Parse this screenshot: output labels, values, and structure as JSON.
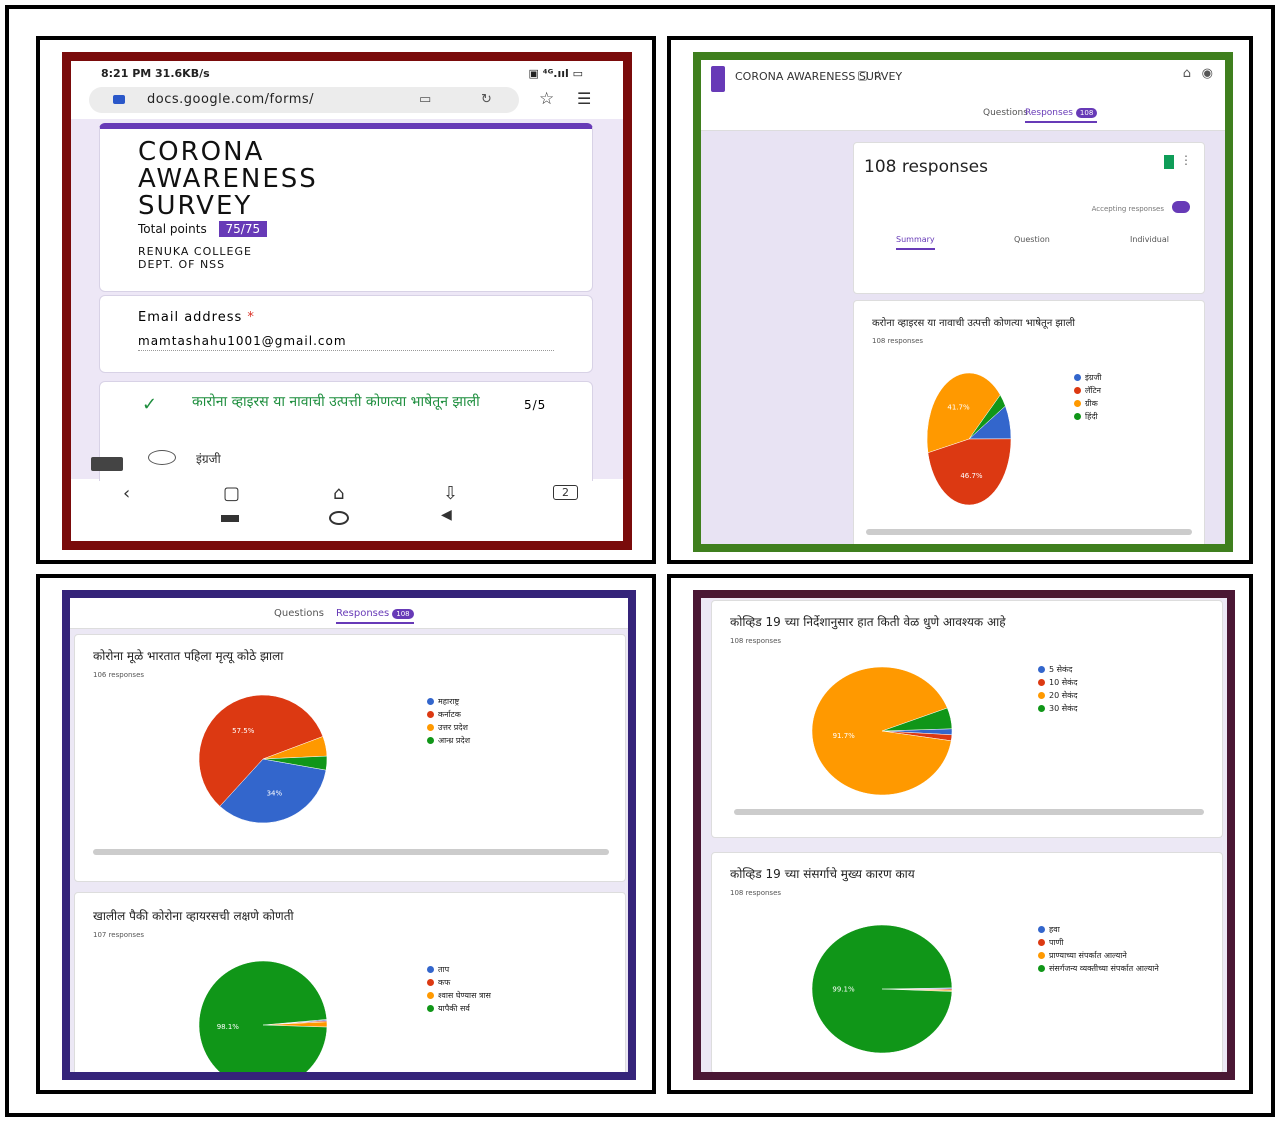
{
  "phone": {
    "status_left": "8:21 PM  31.6KB/s",
    "status_right": "▣ ⁴ᴳ.ııl ▭",
    "url": "docs.google.com/forms/",
    "form_title": "CORONA AWARENESS SURVEY",
    "total_points_label": "Total points",
    "total_points_value": "75/75",
    "college_line1": "RENUKA COLLEGE",
    "college_line2": "DEPT. OF NSS",
    "email_label": "Email address",
    "email_required": "*",
    "email_value": "mamtashahu1001@gmail.com",
    "question": "कारोना व्हाइरस या नावाची उत्पत्ती कोणत्या भाषेतून झाली",
    "question_score": "5/5",
    "option1": "इंग्रजी",
    "tabs_count": "2"
  },
  "panel_tr": {
    "form_title": "CORONA AWARENESS SURVEY",
    "tab_questions": "Questions",
    "tab_responses": "Responses",
    "responses_count": "108",
    "responses_heading": "108 responses",
    "accepting": "Accepting responses",
    "subtab_summary": "Summary",
    "subtab_question": "Question",
    "subtab_individual": "Individual",
    "q_title": "करोना व्हाइरस या नावाची उत्पत्ती कोणत्या भाषेतून झाली",
    "q_count": "108 responses",
    "legend": [
      "इंग्रजी",
      "लॅटिन",
      "ग्रीक",
      "हिंदी"
    ],
    "colors": [
      "#3366cc",
      "#dc3912",
      "#ff9900",
      "#109618"
    ],
    "chart_data": {
      "type": "pie",
      "categories": [
        "इंग्रजी",
        "लॅटिन",
        "ग्रीक",
        "हिंदी"
      ],
      "values": [
        8.3,
        46.7,
        41.7,
        3.3
      ],
      "labels": [
        "",
        "46.7%",
        "41.7%",
        ""
      ]
    }
  },
  "panel_bl": {
    "tab_questions": "Questions",
    "tab_responses": "Responses",
    "responses_count": "108",
    "q1_title": "कोरोना मूळे भारतात पहिला मृत्यू कोठे झाला",
    "q1_count": "106 responses",
    "q1_legend": [
      "महाराष्ट्र",
      "कर्नाटक",
      "उत्तर प्रदेश",
      "आन्ध्र प्रदेश"
    ],
    "q2_title": "खालील पैकी कोरोना व्हायरसची लक्षणे कोणती",
    "q2_count": "107 responses",
    "q2_legend": [
      "ताप",
      "कफ",
      "श्वास घेण्यास त्रास",
      "यापैकी सर्व"
    ],
    "colors": [
      "#3366cc",
      "#dc3912",
      "#ff9900",
      "#109618"
    ],
    "chart_data": [
      {
        "type": "pie",
        "categories": [
          "महाराष्ट्र",
          "कर्नाटक",
          "उत्तर प्रदेश",
          "आन्ध्र प्रदेश"
        ],
        "values": [
          34,
          57.5,
          5,
          3.5
        ],
        "labels": [
          "34%",
          "57.5%",
          "",
          ""
        ]
      },
      {
        "type": "pie",
        "categories": [
          "ताप",
          "कफ",
          "श्वास घेण्यास त्रास",
          "यापैकी सर्व"
        ],
        "values": [
          0.3,
          0.3,
          1.3,
          98.1
        ],
        "labels": [
          "",
          "",
          "",
          "98.1%"
        ]
      }
    ]
  },
  "panel_br": {
    "q1_title": "कोव्हिड 19 च्या निर्देशानुसार हात किती वेळ धुणे आवश्यक आहे",
    "q1_count": "108 responses",
    "q1_legend": [
      "5 सेकंद",
      "10 सेकंद",
      "20 सेकंद",
      "30 सेकंद"
    ],
    "q2_title": "कोव्हिड 19 च्या संसर्गाचे मुख्य कारण काय",
    "q2_count": "108 responses",
    "q2_legend": [
      "हवा",
      "पाणी",
      "प्राण्याच्या संपर्कात आल्याने",
      "संसर्गजन्य व्यक्तीच्या संपर्कात आल्याने"
    ],
    "colors": [
      "#3366cc",
      "#dc3912",
      "#ff9900",
      "#109618"
    ],
    "chart_data": [
      {
        "type": "pie",
        "categories": [
          "5 सेकंद",
          "10 सेकंद",
          "20 सेकंद",
          "30 सेकंद"
        ],
        "values": [
          1.5,
          1.5,
          91.7,
          5.3
        ],
        "labels": [
          "",
          "",
          "91.7%",
          ""
        ]
      },
      {
        "type": "pie",
        "categories": [
          "हवा",
          "पाणी",
          "प्राण्याच्या संपर्कात आल्याने",
          "संसर्गजन्य व्यक्तीच्या संपर्कात आल्याने"
        ],
        "values": [
          0.3,
          0.3,
          0.3,
          99.1
        ],
        "labels": [
          "",
          "",
          "",
          "99.1%"
        ]
      }
    ]
  }
}
